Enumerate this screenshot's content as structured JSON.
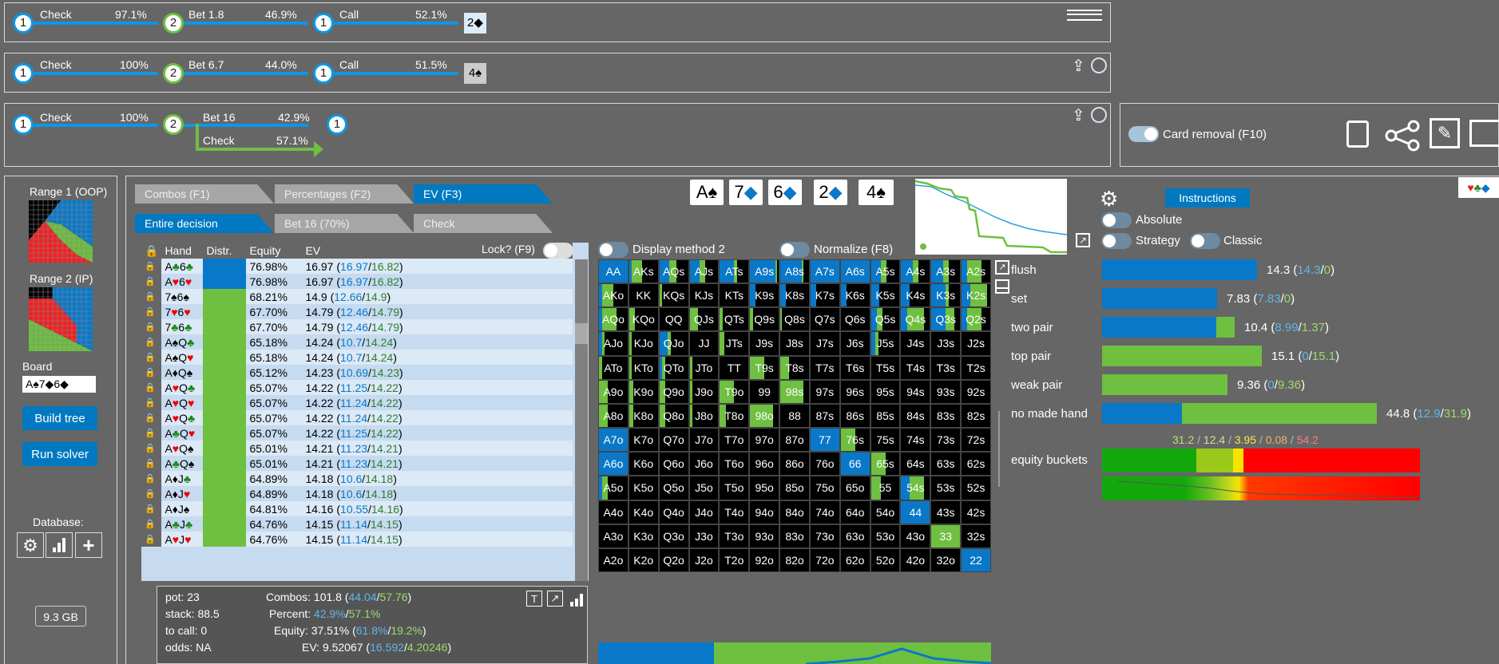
{
  "tree_rows": [
    {
      "actions": [
        {
          "label": "Check",
          "pct": "97.1%"
        },
        {
          "label": "Bet 1.8",
          "pct": "46.9%"
        },
        {
          "label": "Call",
          "pct": "52.1%"
        }
      ],
      "nodes": [
        "1",
        "2",
        "1"
      ],
      "card": "2◆"
    },
    {
      "actions": [
        {
          "label": "Check",
          "pct": "100%"
        },
        {
          "label": "Bet 6.7",
          "pct": "44.0%"
        },
        {
          "label": "Call",
          "pct": "51.5%"
        }
      ],
      "nodes": [
        "1",
        "2",
        "1"
      ],
      "card": "4♠"
    },
    {
      "actions": [
        {
          "label": "Check",
          "pct": "100%"
        },
        {
          "label": "Bet 16",
          "pct": "42.9%"
        },
        {
          "label": "Check",
          "pct": "57.1%"
        }
      ],
      "nodes": [
        "1",
        "2",
        "1"
      ]
    }
  ],
  "card_removal_label": "Card removal (F10)",
  "left": {
    "range1": "Range 1 (OOP)",
    "range2": "Range 2 (IP)",
    "board_label": "Board",
    "board_value": "A♠7◆6◆",
    "build_tree": "Build tree",
    "run_solver": "Run solver",
    "database": "Database:",
    "memory": "9.3 GB"
  },
  "tabs1": [
    "Combos (F1)",
    "Percentages (F2)",
    "EV (F3)"
  ],
  "tabs2": [
    "Entire decision",
    "Bet 16 (70%)",
    "Check"
  ],
  "board_cards": [
    {
      "r": "A",
      "s": "♠",
      "c": "#000"
    },
    {
      "r": "7",
      "s": "◆",
      "c": "#0a78c8"
    },
    {
      "r": "6",
      "s": "◆",
      "c": "#0a78c8"
    },
    {
      "r": "2",
      "s": "◆",
      "c": "#0a78c8"
    },
    {
      "r": "4",
      "s": "♠",
      "c": "#000"
    }
  ],
  "table": {
    "headers": [
      "Hand",
      "Distr.",
      "Equity",
      "EV"
    ],
    "lock_label": "Lock? (F9)",
    "rows": [
      {
        "h": "A♣6♣",
        "d": "b",
        "eq": "76.98%",
        "ev": "16.97",
        "a": "16.97",
        "b": "16.82"
      },
      {
        "h": "A♥6♥",
        "d": "b",
        "eq": "76.98%",
        "ev": "16.97",
        "a": "16.97",
        "b": "16.82"
      },
      {
        "h": "7♠6♠",
        "d": "g",
        "eq": "68.21%",
        "ev": "14.9",
        "a": "12.66",
        "b": "14.9"
      },
      {
        "h": "7♥6♥",
        "d": "g",
        "eq": "67.70%",
        "ev": "14.79",
        "a": "12.46",
        "b": "14.79"
      },
      {
        "h": "7♣6♣",
        "d": "g",
        "eq": "67.70%",
        "ev": "14.79",
        "a": "12.46",
        "b": "14.79"
      },
      {
        "h": "A♠Q♣",
        "d": "g",
        "eq": "65.18%",
        "ev": "14.24",
        "a": "10.7",
        "b": "14.24"
      },
      {
        "h": "A♠Q♥",
        "d": "g",
        "eq": "65.18%",
        "ev": "14.24",
        "a": "10.7",
        "b": "14.24"
      },
      {
        "h": "A♦Q♠",
        "d": "g",
        "eq": "65.12%",
        "ev": "14.23",
        "a": "10.69",
        "b": "14.23"
      },
      {
        "h": "A♥Q♣",
        "d": "g",
        "eq": "65.07%",
        "ev": "14.22",
        "a": "11.25",
        "b": "14.22"
      },
      {
        "h": "A♥Q♥",
        "d": "g",
        "eq": "65.07%",
        "ev": "14.22",
        "a": "11.24",
        "b": "14.22"
      },
      {
        "h": "A♥Q♣",
        "d": "g",
        "eq": "65.07%",
        "ev": "14.22",
        "a": "11.24",
        "b": "14.22"
      },
      {
        "h": "A♣Q♥",
        "d": "g",
        "eq": "65.07%",
        "ev": "14.22",
        "a": "11.25",
        "b": "14.22"
      },
      {
        "h": "A♥Q♠",
        "d": "g",
        "eq": "65.01%",
        "ev": "14.21",
        "a": "11.23",
        "b": "14.21"
      },
      {
        "h": "A♣Q♠",
        "d": "g",
        "eq": "65.01%",
        "ev": "14.21",
        "a": "11.23",
        "b": "14.21"
      },
      {
        "h": "A♦J♣",
        "d": "g",
        "eq": "64.89%",
        "ev": "14.18",
        "a": "10.6",
        "b": "14.18"
      },
      {
        "h": "A♦J♥",
        "d": "g",
        "eq": "64.89%",
        "ev": "14.18",
        "a": "10.6",
        "b": "14.18"
      },
      {
        "h": "A♦J♠",
        "d": "g",
        "eq": "64.81%",
        "ev": "14.16",
        "a": "10.55",
        "b": "14.16"
      },
      {
        "h": "A♣J♣",
        "d": "g",
        "eq": "64.76%",
        "ev": "14.15",
        "a": "11.14",
        "b": "14.15"
      },
      {
        "h": "A♥J♥",
        "d": "g",
        "eq": "64.76%",
        "ev": "14.15",
        "a": "11.14",
        "b": "14.15"
      }
    ]
  },
  "stats": {
    "pot": "pot: 23",
    "stack": "stack: 88.5",
    "to_call": "to call: 0",
    "odds": "odds: NA",
    "combos_label": "Combos:",
    "combos": "101.8",
    "combos_a": "44.04",
    "combos_b": "57.76",
    "percent_label": "Percent:",
    "percent_a": "42.9%",
    "percent_b": "57.1%",
    "equity_label": "Equity:",
    "equity": "37.51%",
    "equity_a": "61.8%",
    "equity_b": "19.2%",
    "ev_label": "EV:",
    "ev": "9.52067",
    "ev_a": "16.592",
    "ev_b": "4.20246"
  },
  "matrix_options": {
    "display": "Display method 2",
    "normalize": "Normalize (F8)"
  },
  "matrix": [
    [
      "AA",
      "AKs",
      "AQs",
      "AJs",
      "ATs",
      "A9s",
      "A8s",
      "A7s",
      "A6s",
      "A5s",
      "A4s",
      "A3s",
      "A2s"
    ],
    [
      "AKo",
      "KK",
      "KQs",
      "KJs",
      "KTs",
      "K9s",
      "K8s",
      "K7s",
      "K6s",
      "K5s",
      "K4s",
      "K3s",
      "K2s"
    ],
    [
      "AQo",
      "KQo",
      "QQ",
      "QJs",
      "QTs",
      "Q9s",
      "Q8s",
      "Q7s",
      "Q6s",
      "Q5s",
      "Q4s",
      "Q3s",
      "Q2s"
    ],
    [
      "AJo",
      "KJo",
      "QJo",
      "JJ",
      "JTs",
      "J9s",
      "J8s",
      "J7s",
      "J6s",
      "J5s",
      "J4s",
      "J3s",
      "J2s"
    ],
    [
      "ATo",
      "KTo",
      "QTo",
      "JTo",
      "TT",
      "T9s",
      "T8s",
      "T7s",
      "T6s",
      "T5s",
      "T4s",
      "T3s",
      "T2s"
    ],
    [
      "A9o",
      "K9o",
      "Q9o",
      "J9o",
      "T9o",
      "99",
      "98s",
      "97s",
      "96s",
      "95s",
      "94s",
      "93s",
      "92s"
    ],
    [
      "A8o",
      "K8o",
      "Q8o",
      "J8o",
      "T8o",
      "98o",
      "88",
      "87s",
      "86s",
      "85s",
      "84s",
      "83s",
      "82s"
    ],
    [
      "A7o",
      "K7o",
      "Q7o",
      "J7o",
      "T7o",
      "97o",
      "87o",
      "77",
      "76s",
      "75s",
      "74s",
      "73s",
      "72s"
    ],
    [
      "A6o",
      "K6o",
      "Q6o",
      "J6o",
      "T6o",
      "96o",
      "86o",
      "76o",
      "66",
      "65s",
      "64s",
      "63s",
      "62s"
    ],
    [
      "A5o",
      "K5o",
      "Q5o",
      "J5o",
      "T5o",
      "95o",
      "85o",
      "75o",
      "65o",
      "55",
      "54s",
      "53s",
      "52s"
    ],
    [
      "A4o",
      "K4o",
      "Q4o",
      "J4o",
      "T4o",
      "94o",
      "84o",
      "74o",
      "64o",
      "54o",
      "44",
      "43s",
      "42s"
    ],
    [
      "A3o",
      "K3o",
      "Q3o",
      "J3o",
      "T3o",
      "93o",
      "83o",
      "73o",
      "63o",
      "53o",
      "43o",
      "33",
      "32s"
    ],
    [
      "A2o",
      "K2o",
      "Q2o",
      "J2o",
      "T2o",
      "92o",
      "82o",
      "72o",
      "62o",
      "52o",
      "42o",
      "32o",
      "22"
    ]
  ],
  "right": {
    "instructions": "Instructions",
    "absolute": "Absolute",
    "strategy": "Strategy",
    "classic": "Classic",
    "categories": [
      {
        "name": "flush",
        "main": "14.3",
        "a": "14.3",
        "b": "0",
        "blue": 1.0
      },
      {
        "name": "set",
        "main": "7.83",
        "a": "7.83",
        "b": "0",
        "blue": 1.0
      },
      {
        "name": "two pair",
        "main": "10.4",
        "a": "8.99",
        "b": "1.37",
        "blue": 0.86
      },
      {
        "name": "top pair",
        "main": "15.1",
        "a": "0",
        "b": "15.1",
        "blue": 0.0
      },
      {
        "name": "weak pair",
        "main": "9.36",
        "a": "0",
        "b": "9.36",
        "blue": 0.0
      },
      {
        "name": "no made hand",
        "main": "44.8",
        "a": "12.9",
        "b": "31.9",
        "blue": 0.29
      }
    ],
    "bucket_vals": [
      "31.2",
      "12.4",
      "3.95",
      "0.08",
      "54.2"
    ],
    "equity_buckets": "equity buckets"
  },
  "colors": {
    "blue": "#0a78c8",
    "green": "#6fbf40",
    "accent": "#0079c1",
    "red": "#f00"
  }
}
